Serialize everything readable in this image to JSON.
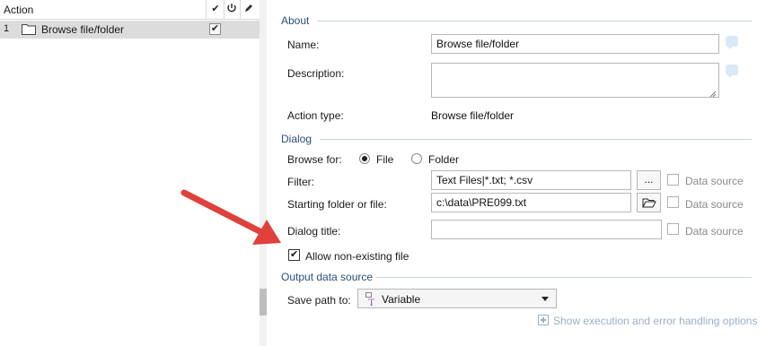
{
  "action_list": {
    "header_title": "Action",
    "header_icons": [
      "checkmark-icon",
      "power-icon",
      "pencil-icon"
    ],
    "rows": [
      {
        "number": "1",
        "label": "Browse file/folder",
        "enabled": true
      }
    ]
  },
  "about": {
    "section_title": "About",
    "name_label": "Name:",
    "name_value": "Browse file/folder",
    "description_label": "Description:",
    "description_value": "",
    "action_type_label": "Action type:",
    "action_type_value": "Browse file/folder"
  },
  "dialog": {
    "section_title": "Dialog",
    "browse_for_label": "Browse for:",
    "browse_options": [
      {
        "label": "File",
        "selected": true
      },
      {
        "label": "Folder",
        "selected": false
      }
    ],
    "filter_label": "Filter:",
    "filter_value": "Text Files|*.txt; *.csv",
    "filter_button": "...",
    "starting_folder_label": "Starting folder or file:",
    "starting_folder_value": "c:\\data\\PRE099.txt",
    "dialog_title_label": "Dialog title:",
    "dialog_title_value": "",
    "data_source_label": "Data source",
    "allow_nonexisting_label": "Allow non-existing file",
    "allow_nonexisting_checked": true
  },
  "output": {
    "section_title": "Output data source",
    "save_path_label": "Save path to:",
    "save_path_value": "Variable"
  },
  "footer": {
    "show_options_link": "Show execution and error handling options"
  },
  "colors": {
    "section_title": "#2a4f7a",
    "selected_row": "#dcdcdc",
    "annotation_arrow": "#e0413a",
    "variable_icon": "#9b59b6"
  }
}
